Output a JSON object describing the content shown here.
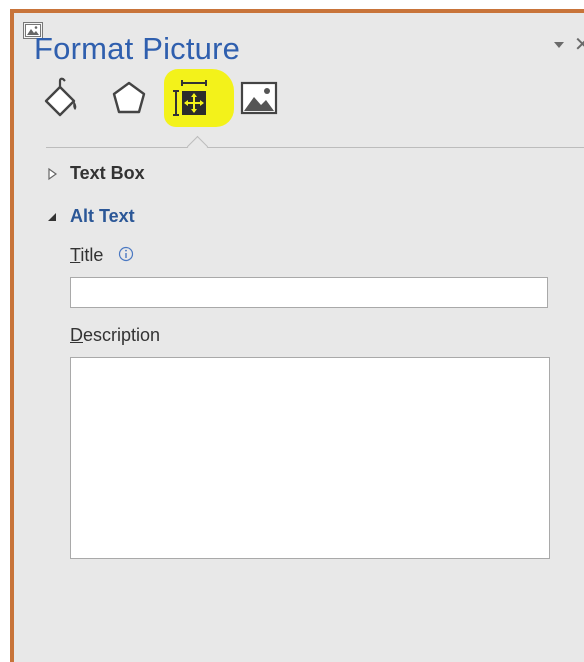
{
  "pane": {
    "title": "Format Picture",
    "icons": {
      "app": "picture-app-icon",
      "menu": "chevron-down-icon",
      "close": "close-icon"
    }
  },
  "tabs": [
    {
      "name": "fill-and-line",
      "icon": "paint-bucket-icon"
    },
    {
      "name": "effects",
      "icon": "pentagon-icon"
    },
    {
      "name": "layout-and-properties",
      "icon": "size-properties-icon",
      "selected": true
    },
    {
      "name": "picture",
      "icon": "picture-icon"
    }
  ],
  "sections": {
    "text_box": {
      "label": "Text Box",
      "expanded": false
    },
    "alt_text": {
      "label": "Alt Text",
      "expanded": true
    }
  },
  "fields": {
    "title": {
      "mnemonic": "T",
      "rest": "itle",
      "value": ""
    },
    "description": {
      "mnemonic": "D",
      "rest": "escription",
      "value": ""
    }
  },
  "colors": {
    "accent": "#2f5fae",
    "section_accent": "#2b5797",
    "highlight": "#f3f21a",
    "border": "#c8743a",
    "pane_bg": "#e8e8e8"
  }
}
